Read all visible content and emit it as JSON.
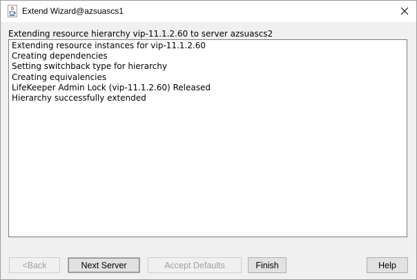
{
  "window": {
    "title": "Extend Wizard@azsuascs1",
    "close_glyph": "✕",
    "icon": "java-cup-icon"
  },
  "status_line": "Extending resource hierarchy vip-11.1.2.60 to server azsuascs2",
  "log_lines": [
    "Extending resource instances for vip-11.1.2.60",
    "Creating dependencies",
    "Setting switchback type for hierarchy",
    "Creating equivalencies",
    "LifeKeeper Admin Lock (vip-11.1.2.60) Released",
    "Hierarchy successfully extended"
  ],
  "buttons": {
    "back": {
      "label": "<Back",
      "enabled": false
    },
    "next_server": {
      "label": "Next Server",
      "enabled": true
    },
    "accept_defaults": {
      "label": "Accept Defaults",
      "enabled": false
    },
    "finish": {
      "label": "Finish",
      "enabled": true
    },
    "help": {
      "label": "Help",
      "enabled": true
    }
  }
}
